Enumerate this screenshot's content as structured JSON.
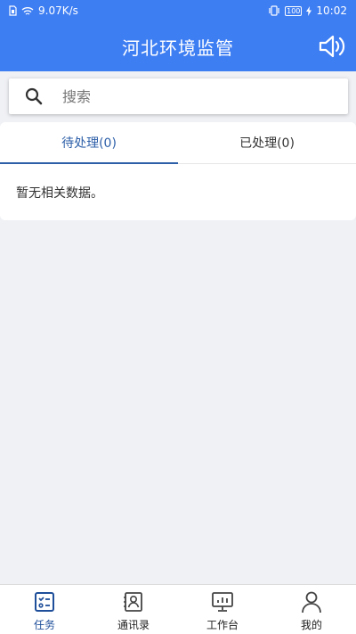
{
  "status_bar": {
    "net_speed": "9.07K/s",
    "battery": "100",
    "time": "10:02"
  },
  "app_bar": {
    "title": "河北环境监管",
    "sound_icon": "speaker-icon"
  },
  "search": {
    "placeholder": "搜索"
  },
  "tabs": [
    {
      "label": "待处理(0)",
      "active": true
    },
    {
      "label": "已处理(0)",
      "active": false
    }
  ],
  "list": {
    "empty_text": "暂无相关数据。"
  },
  "bottom_nav": [
    {
      "label": "任务",
      "icon": "task-icon",
      "active": true
    },
    {
      "label": "通讯录",
      "icon": "contacts-icon",
      "active": false
    },
    {
      "label": "工作台",
      "icon": "workbench-icon",
      "active": false
    },
    {
      "label": "我的",
      "icon": "profile-icon",
      "active": false
    }
  ],
  "colors": {
    "primary": "#3e7ef3",
    "tab_active": "#2d5fa8",
    "nav_active": "#1f4f9a",
    "background": "#f0f1f5"
  }
}
